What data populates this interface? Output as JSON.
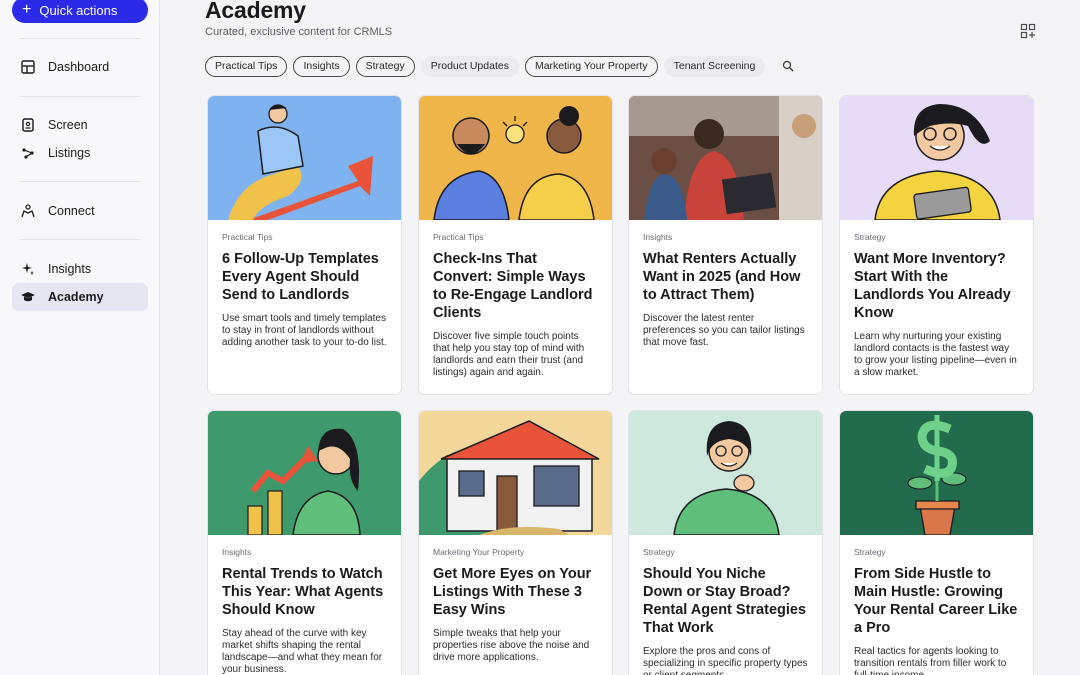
{
  "sidebar": {
    "quick_actions": "Quick actions",
    "items": [
      {
        "label": "Dashboard",
        "icon": "dashboard-icon"
      },
      {
        "label": "Screen",
        "icon": "screen-icon"
      },
      {
        "label": "Listings",
        "icon": "listings-icon"
      },
      {
        "label": "Connect",
        "icon": "connect-icon"
      },
      {
        "label": "Insights",
        "icon": "insights-icon"
      },
      {
        "label": "Academy",
        "icon": "academy-icon",
        "active": true
      }
    ]
  },
  "header": {
    "title": "Academy",
    "subtitle": "Curated, exclusive content for CRMLS"
  },
  "filters": [
    {
      "label": "Practical Tips",
      "selected": true
    },
    {
      "label": "Insights",
      "selected": true
    },
    {
      "label": "Strategy",
      "selected": true
    },
    {
      "label": "Product Updates",
      "selected": false
    },
    {
      "label": "Marketing Your Property",
      "selected": true
    },
    {
      "label": "Tenant Screening",
      "selected": false
    }
  ],
  "cards": [
    {
      "category": "Practical Tips",
      "title": "6 Follow-Up Templates Every Agent Should Send to Landlords",
      "desc": "Use smart tools and timely templates to stay in front of landlords without adding another task to your to-do list.",
      "bg": "#7fb3f0"
    },
    {
      "category": "Practical Tips",
      "title": "Check-Ins That Convert: Simple Ways to Re-Engage Landlord Clients",
      "desc": "Discover five simple touch points that help you stay top of mind with landlords and earn their trust (and listings) again and again.",
      "bg": "#f0b64a"
    },
    {
      "category": "Insights",
      "title": "What Renters Actually Want in 2025 (and How to Attract Them)",
      "desc": "Discover the latest renter preferences so you can tailor listings that move fast.",
      "bg": "#6b4f45"
    },
    {
      "category": "Strategy",
      "title": "Want More Inventory? Start With the Landlords You Already Know",
      "desc": "Learn why nurturing your existing landlord contacts is the fastest way to grow your listing pipeline—even in a slow market.",
      "bg": "#e6dcf8"
    },
    {
      "category": "Insights",
      "title": "Rental Trends to Watch This Year: What Agents Should Know",
      "desc": "Stay ahead of the curve with key market shifts shaping the rental landscape—and what they mean for your business.",
      "bg": "#3e9a6c"
    },
    {
      "category": "Marketing Your Property",
      "title": "Get More Eyes on Your Listings With These 3 Easy Wins",
      "desc": "Simple tweaks that help your properties rise above the noise and drive more applications.",
      "bg": "#f4d79a"
    },
    {
      "category": "Strategy",
      "title": "Should You Niche Down or Stay Broad? Rental Agent Strategies That Work",
      "desc": "Explore the pros and cons of specializing in specific property types or client segments.",
      "bg": "#cfe8de"
    },
    {
      "category": "Strategy",
      "title": "From Side Hustle to Main Hustle: Growing Your Rental Career Like a Pro",
      "desc": "Real tactics for agents looking to transition rentals from filler work to full-time income.",
      "bg": "#226b4d"
    }
  ]
}
